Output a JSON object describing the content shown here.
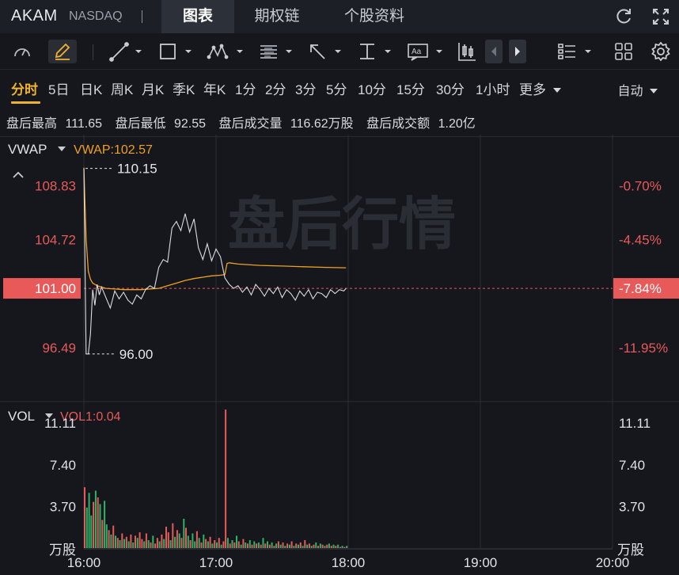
{
  "header": {
    "ticker": "AKAM",
    "exchange": "NASDAQ",
    "tabs": [
      {
        "label": "图表",
        "active": true
      },
      {
        "label": "期权链",
        "active": false
      },
      {
        "label": "个股资料",
        "active": false
      }
    ]
  },
  "toolbar": {
    "icons": [
      "gauge-icon",
      "pen-icon",
      "line-tool-icon",
      "rectangle-tool-icon",
      "pattern-tool-icon",
      "fib-tool-icon",
      "arrow-tool-icon",
      "measure-tool-icon",
      "text-tool-icon",
      "candle-type-icon",
      "prev-icon",
      "next-icon",
      "layout-list-icon",
      "grid-icon",
      "settings-icon"
    ]
  },
  "periods": {
    "items": [
      "分时",
      "5日",
      "日K",
      "周K",
      "月K",
      "季K",
      "年K",
      "1分",
      "2分",
      "3分",
      "5分",
      "10分",
      "15分",
      "30分",
      "1小时",
      "更多"
    ],
    "active": "分时",
    "auto_label": "自动"
  },
  "stats": {
    "items": [
      {
        "label": "盘后最高",
        "value": "111.65"
      },
      {
        "label": "盘后最低",
        "value": "92.55"
      },
      {
        "label": "盘后成交量",
        "value": "116.62万股"
      },
      {
        "label": "盘后成交额",
        "value": "1.20亿"
      }
    ]
  },
  "colors": {
    "up": "#e85a5a",
    "down": "#2db367",
    "vwap": "#f0a022",
    "accent": "#f0b232",
    "price_line": "#dcdde0"
  },
  "chart_data": [
    {
      "type": "line",
      "title": "",
      "indicator_name": "VWAP",
      "indicator_value": "VWAP:102.57",
      "watermark": "盘后行情",
      "x_ticks": [
        "16:00",
        "17:00",
        "18:00",
        "19:00",
        "20:00"
      ],
      "x_range": [
        0,
        240
      ],
      "ylim": [
        92.55,
        112.6
      ],
      "left_tick_labels": [
        "108.83",
        "104.72",
        "101.00",
        "96.49"
      ],
      "left_tick_values": [
        108.83,
        104.72,
        101.0,
        96.49
      ],
      "right_tick_labels": [
        "-0.70%",
        "-4.45%",
        "-7.84%",
        "-11.95%"
      ],
      "reference_price": 101.0,
      "high_marker": {
        "label": "110.15",
        "value": 110.15,
        "x": 0
      },
      "low_marker": {
        "label": "96.00",
        "value": 96.0,
        "x": 1
      },
      "series": [
        {
          "name": "price",
          "x": [
            0,
            1,
            2,
            3,
            4,
            5,
            6,
            7,
            8,
            10,
            12,
            14,
            16,
            18,
            20,
            22,
            24,
            26,
            28,
            30,
            32,
            34,
            36,
            38,
            40,
            42,
            44,
            46,
            48,
            50,
            52,
            54,
            56,
            58,
            60,
            62,
            64,
            66,
            68,
            70,
            72,
            74,
            76,
            78,
            80,
            82,
            84,
            86,
            88,
            90,
            92,
            94,
            96,
            98,
            100,
            102,
            104,
            106,
            108,
            110,
            112,
            114,
            116,
            118,
            119
          ],
          "y": [
            110.15,
            96.0,
            96.0,
            97.5,
            100.9,
            99.7,
            101.3,
            100.5,
            101.1,
            100.3,
            99.5,
            100.8,
            100.2,
            100.7,
            100.1,
            99.8,
            100.5,
            100.2,
            100.9,
            101.2,
            101.0,
            102.6,
            103.2,
            103.0,
            105.6,
            106.1,
            105.4,
            106.7,
            105.3,
            106.3,
            104.1,
            103.2,
            104.4,
            103.1,
            104.0,
            103.4,
            101.8,
            101.3,
            101.0,
            101.2,
            100.7,
            101.1,
            100.5,
            101.3,
            100.9,
            100.4,
            101.0,
            100.6,
            101.1,
            100.3,
            100.9,
            100.6,
            100.1,
            100.8,
            100.4,
            100.9,
            100.2,
            100.7,
            100.6,
            100.3,
            100.9,
            100.6,
            100.9,
            100.8,
            101.0
          ]
        },
        {
          "name": "VWAP",
          "x": [
            0,
            1,
            2,
            3,
            4,
            5,
            6,
            8,
            10,
            14,
            18,
            22,
            26,
            30,
            34,
            38,
            42,
            46,
            50,
            54,
            58,
            62,
            64,
            65,
            66,
            70,
            80,
            90,
            100,
            110,
            119
          ],
          "y": [
            110.2,
            104.8,
            102.3,
            101.7,
            101.4,
            101.3,
            101.2,
            101.1,
            101.0,
            100.95,
            100.9,
            100.9,
            100.9,
            100.95,
            101.0,
            101.2,
            101.4,
            101.6,
            101.75,
            101.85,
            101.95,
            102.0,
            102.05,
            102.9,
            102.95,
            102.85,
            102.75,
            102.7,
            102.65,
            102.6,
            102.57
          ]
        }
      ]
    },
    {
      "type": "bar",
      "title": "",
      "indicator_name": "VOL",
      "indicator_value": "VOL1:0.04",
      "unit_label": "万股",
      "tick_labels": [
        "11.11",
        "7.40",
        "3.70"
      ],
      "tick_values": [
        11.11,
        7.4,
        3.7
      ],
      "ylim": [
        0,
        12.8
      ],
      "x_range": [
        0,
        240
      ],
      "series": [
        {
          "name": "VOL",
          "x": [
            0,
            1,
            2,
            3,
            4,
            5,
            6,
            7,
            8,
            9,
            10,
            11,
            12,
            13,
            14,
            15,
            16,
            17,
            18,
            19,
            20,
            21,
            22,
            23,
            24,
            25,
            26,
            27,
            28,
            29,
            30,
            31,
            32,
            33,
            34,
            35,
            36,
            37,
            38,
            39,
            40,
            41,
            42,
            43,
            44,
            45,
            46,
            47,
            48,
            49,
            50,
            51,
            52,
            53,
            54,
            55,
            56,
            57,
            58,
            59,
            60,
            61,
            62,
            63,
            64,
            65,
            66,
            67,
            68,
            69,
            70,
            71,
            72,
            73,
            74,
            75,
            76,
            77,
            78,
            79,
            80,
            81,
            82,
            83,
            84,
            85,
            86,
            87,
            88,
            89,
            90,
            91,
            92,
            93,
            94,
            95,
            96,
            97,
            98,
            99,
            100,
            101,
            102,
            103,
            104,
            105,
            106,
            107,
            108,
            109,
            110,
            111,
            112,
            113,
            114,
            115,
            116,
            117,
            118,
            119
          ],
          "values": [
            5.4,
            3.6,
            4.9,
            2.9,
            4.1,
            5.1,
            4.5,
            3.9,
            2.5,
            4.2,
            2.1,
            1.6,
            1.2,
            2.0,
            1.1,
            0.9,
            0.7,
            1.3,
            0.8,
            1.0,
            0.6,
            1.2,
            0.5,
            1.1,
            0.9,
            1.4,
            0.8,
            0.6,
            1.3,
            0.7,
            0.5,
            1.1,
            0.4,
            0.9,
            0.6,
            1.2,
            0.8,
            1.9,
            1.4,
            0.7,
            2.2,
            1.0,
            1.6,
            1.3,
            0.9,
            2.6,
            1.8,
            1.1,
            0.7,
            1.3,
            0.6,
            1.5,
            0.9,
            0.5,
            1.2,
            0.8,
            0.6,
            1.0,
            0.4,
            0.7,
            0.5,
            0.9,
            0.3,
            0.6,
            12.3,
            0.9,
            0.4,
            0.7,
            0.5,
            1.1,
            0.6,
            0.3,
            0.8,
            0.5,
            0.4,
            0.7,
            0.3,
            0.6,
            0.4,
            0.5,
            0.3,
            0.9,
            0.4,
            0.6,
            0.3,
            0.5,
            0.2,
            0.4,
            0.6,
            0.3,
            0.5,
            0.2,
            0.4,
            0.3,
            0.6,
            0.2,
            0.4,
            0.3,
            0.5,
            0.2,
            0.7,
            0.3,
            0.4,
            0.2,
            0.3,
            0.5,
            0.2,
            0.4,
            0.3,
            0.2,
            0.3,
            0.4,
            0.2,
            0.3,
            0.2,
            0.3,
            0.1,
            0.2,
            0.1,
            0.2
          ],
          "direction": [
            "up",
            "down",
            "down",
            "down",
            "up",
            "down",
            "up",
            "down",
            "up",
            "down",
            "down",
            "up",
            "down",
            "up",
            "down",
            "up",
            "down",
            "up",
            "down",
            "up",
            "down",
            "up",
            "down",
            "up",
            "down",
            "up",
            "up",
            "down",
            "up",
            "down",
            "up",
            "down",
            "up",
            "up",
            "down",
            "up",
            "down",
            "up",
            "up",
            "down",
            "up",
            "down",
            "up",
            "down",
            "up",
            "down",
            "up",
            "down",
            "up",
            "down",
            "down",
            "up",
            "down",
            "up",
            "down",
            "up",
            "down",
            "up",
            "down",
            "up",
            "down",
            "up",
            "down",
            "up",
            "up",
            "down",
            "up",
            "down",
            "up",
            "down",
            "up",
            "down",
            "up",
            "down",
            "up",
            "down",
            "up",
            "down",
            "up",
            "down",
            "up",
            "down",
            "up",
            "down",
            "up",
            "down",
            "up",
            "down",
            "up",
            "down",
            "up",
            "down",
            "up",
            "down",
            "up",
            "down",
            "up",
            "down",
            "up",
            "down",
            "up",
            "down",
            "up",
            "down",
            "up",
            "down",
            "up",
            "down",
            "up",
            "down",
            "up",
            "down",
            "up",
            "down",
            "up",
            "down",
            "up",
            "down",
            "up",
            "down"
          ]
        }
      ]
    }
  ]
}
